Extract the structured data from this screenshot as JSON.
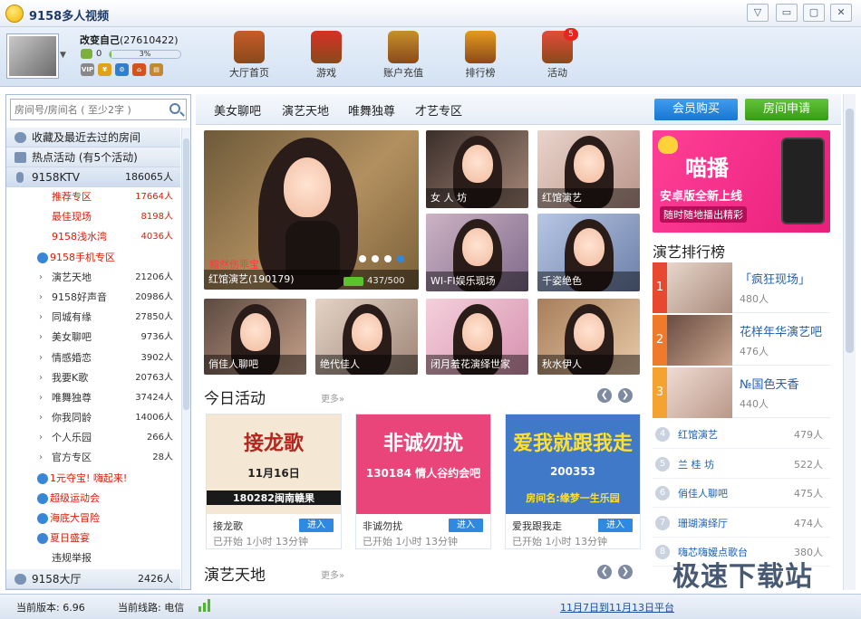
{
  "app": {
    "title": "9158多人视频"
  },
  "user": {
    "nickname": "改变自己",
    "id": "(27610422)",
    "level": "0",
    "exp_percent": 3,
    "exp_text": "3%"
  },
  "topnav": [
    {
      "label": "大厅首页",
      "icon": "house-icon"
    },
    {
      "label": "游戏",
      "icon": "joystick-icon"
    },
    {
      "label": "账户充值",
      "icon": "wallet-icon"
    },
    {
      "label": "排行榜",
      "icon": "podium-icon"
    },
    {
      "label": "活动",
      "icon": "gift-icon",
      "badge": "5"
    }
  ],
  "search": {
    "placeholder": "房间号/房间名 ( 至少2字 )"
  },
  "tree": {
    "favorites": "收藏及最近去过的房间",
    "hot": "热点活动 (有5个活动)",
    "ktv": {
      "name": "9158KTV",
      "count": "186065人"
    },
    "red_rows": [
      {
        "name": "推荐专区",
        "count": "17664人"
      },
      {
        "name": "最佳现场",
        "count": "8198人"
      },
      {
        "name": "9158浅水湾",
        "count": "4036人"
      }
    ],
    "mobile": "9158手机专区",
    "sub_rows": [
      {
        "name": "演艺天地",
        "count": "21206人"
      },
      {
        "name": "9158好声音",
        "count": "20986人"
      },
      {
        "name": "同城有缘",
        "count": "27850人"
      },
      {
        "name": "美女聊吧",
        "count": "9736人"
      },
      {
        "name": "情感婚恋",
        "count": "3902人"
      },
      {
        "name": "我要K歌",
        "count": "20763人"
      },
      {
        "name": "唯舞独尊",
        "count": "37424人"
      },
      {
        "name": "你我同龄",
        "count": "14006人"
      },
      {
        "name": "个人乐园",
        "count": "266人"
      },
      {
        "name": "官方专区",
        "count": "28人"
      }
    ],
    "events": [
      "1元夺宝! 嗨起来!",
      "超级运动会",
      "海底大冒险",
      "夏日盛宴"
    ],
    "report": "违规举报",
    "bottom": {
      "name": "9158大厅",
      "count": "2426人"
    }
  },
  "categories": [
    "美女聊吧",
    "演艺天地",
    "唯舞独尊",
    "才艺专区"
  ],
  "buttons": {
    "vip": "会员购买",
    "apply": "房间申请"
  },
  "featured": {
    "tag": "黯然伤乖宝",
    "caption": "红馆演艺(190179)",
    "viewers": "437/500"
  },
  "tiles": [
    "女 人 坊",
    "红馆演艺",
    "WI-FI娱乐现场",
    "千姿绝色",
    "俏佳人聊吧",
    "绝代佳人",
    "闭月羞花演绎世家",
    "秋水伊人"
  ],
  "today": {
    "title": "今日活动",
    "more": "更多»"
  },
  "activities": [
    {
      "banner_title": "接龙歌",
      "banner_sub": "11月16日",
      "banner_line": "180282闽南赣果",
      "name": "接龙歌",
      "enter": "进入",
      "status": "已开始  1小时 13分钟",
      "colors": [
        "#f4e7d3",
        "#b3261e"
      ]
    },
    {
      "banner_title": "非诚勿扰",
      "banner_sub": "130184 情人谷约会吧",
      "banner_line": "",
      "name": "非诚勿扰",
      "enter": "进入",
      "status": "已开始  1小时 13分钟",
      "colors": [
        "#e9457a",
        "#ffffff"
      ]
    },
    {
      "banner_title": "爱我就跟我走",
      "banner_sub": "200353",
      "banner_line": "房间名:缘梦一生乐园",
      "name": "爱我跟我走",
      "enter": "进入",
      "status": "已开始  1小时 13分钟",
      "colors": [
        "#3f79c8",
        "#ffe02e"
      ]
    }
  ],
  "arts": {
    "title": "演艺天地",
    "more": "更多»"
  },
  "ad": {
    "title": "喵播",
    "line1": "安卓版全新上线",
    "line2": "随时随地播出精彩"
  },
  "ranking": {
    "title": "演艺排行榜",
    "top": [
      {
        "rank": "1",
        "name": "「疯狂现场」",
        "count": "480人",
        "color": "#e8482f"
      },
      {
        "rank": "2",
        "name": "花样年华演艺吧",
        "count": "476人",
        "color": "#f07a2c"
      },
      {
        "rank": "3",
        "name": "№国色天香",
        "count": "440人",
        "color": "#f4a230"
      }
    ],
    "rest": [
      {
        "rank": "4",
        "name": "红馆演艺",
        "count": "479人"
      },
      {
        "rank": "5",
        "name": "兰 桂 坊",
        "count": "522人"
      },
      {
        "rank": "6",
        "name": "俏佳人聊吧",
        "count": "475人"
      },
      {
        "rank": "7",
        "name": "珊瑚演绎厅",
        "count": "474人"
      },
      {
        "rank": "8",
        "name": "嗨芯嗨嫒点歌台",
        "count": "380人"
      }
    ]
  },
  "status": {
    "version": "当前版本: 6.96",
    "line": "当前线路: 电信",
    "notice": "11月7日到11月13日平台"
  },
  "watermark": "极速下载站"
}
